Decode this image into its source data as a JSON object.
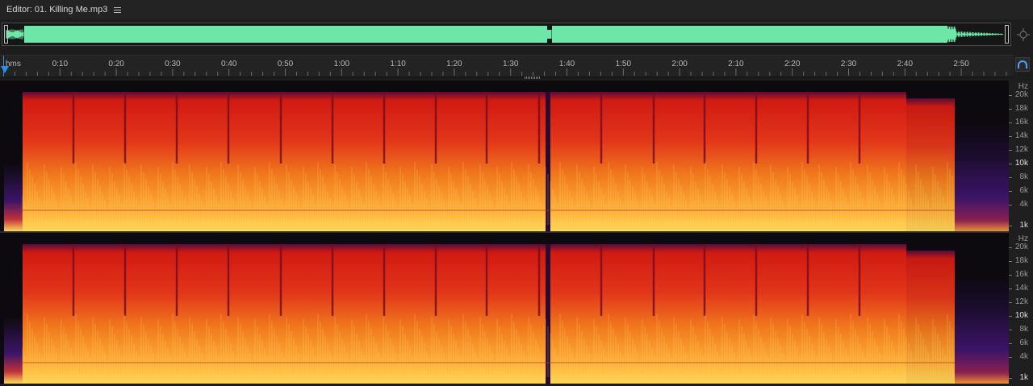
{
  "editor": {
    "title": "Editor: 01. Killing Me.mp3",
    "menu_icon": "hamburger-menu-icon"
  },
  "overview": {
    "waveform_color": "#6ee6a8",
    "zoom_icon": "zoom-navigator-icon"
  },
  "timeline": {
    "unit_label": "hms",
    "ticks": [
      "0:10",
      "0:20",
      "0:30",
      "0:40",
      "0:50",
      "1:00",
      "1:10",
      "1:20",
      "1:30",
      "1:40",
      "1:50",
      "2:00",
      "2:10",
      "2:20",
      "2:30",
      "2:40",
      "2:50"
    ],
    "snap_icon": "magnet-snap-icon",
    "playhead_color": "#2e8ce8"
  },
  "spectral": {
    "channels": [
      {
        "name": "left",
        "unit": "Hz",
        "labels": [
          "20k",
          "18k",
          "16k",
          "14k",
          "12k",
          "10k",
          "8k",
          "6k",
          "4k",
          "1k"
        ],
        "bright_labels": [
          "10k",
          "1k"
        ]
      },
      {
        "name": "right",
        "unit": "Hz",
        "labels": [
          "20k",
          "18k",
          "16k",
          "14k",
          "12k",
          "10k",
          "8k",
          "6k",
          "4k",
          "1k"
        ],
        "bright_labels": [
          "10k",
          "1k"
        ]
      }
    ],
    "colors": {
      "low": "#ffd85a",
      "mid": "#f07a1c",
      "high": "#d01a12",
      "top": "#5a0a3a",
      "silence": "#0c0a0e",
      "edge": "#3c1468"
    }
  }
}
